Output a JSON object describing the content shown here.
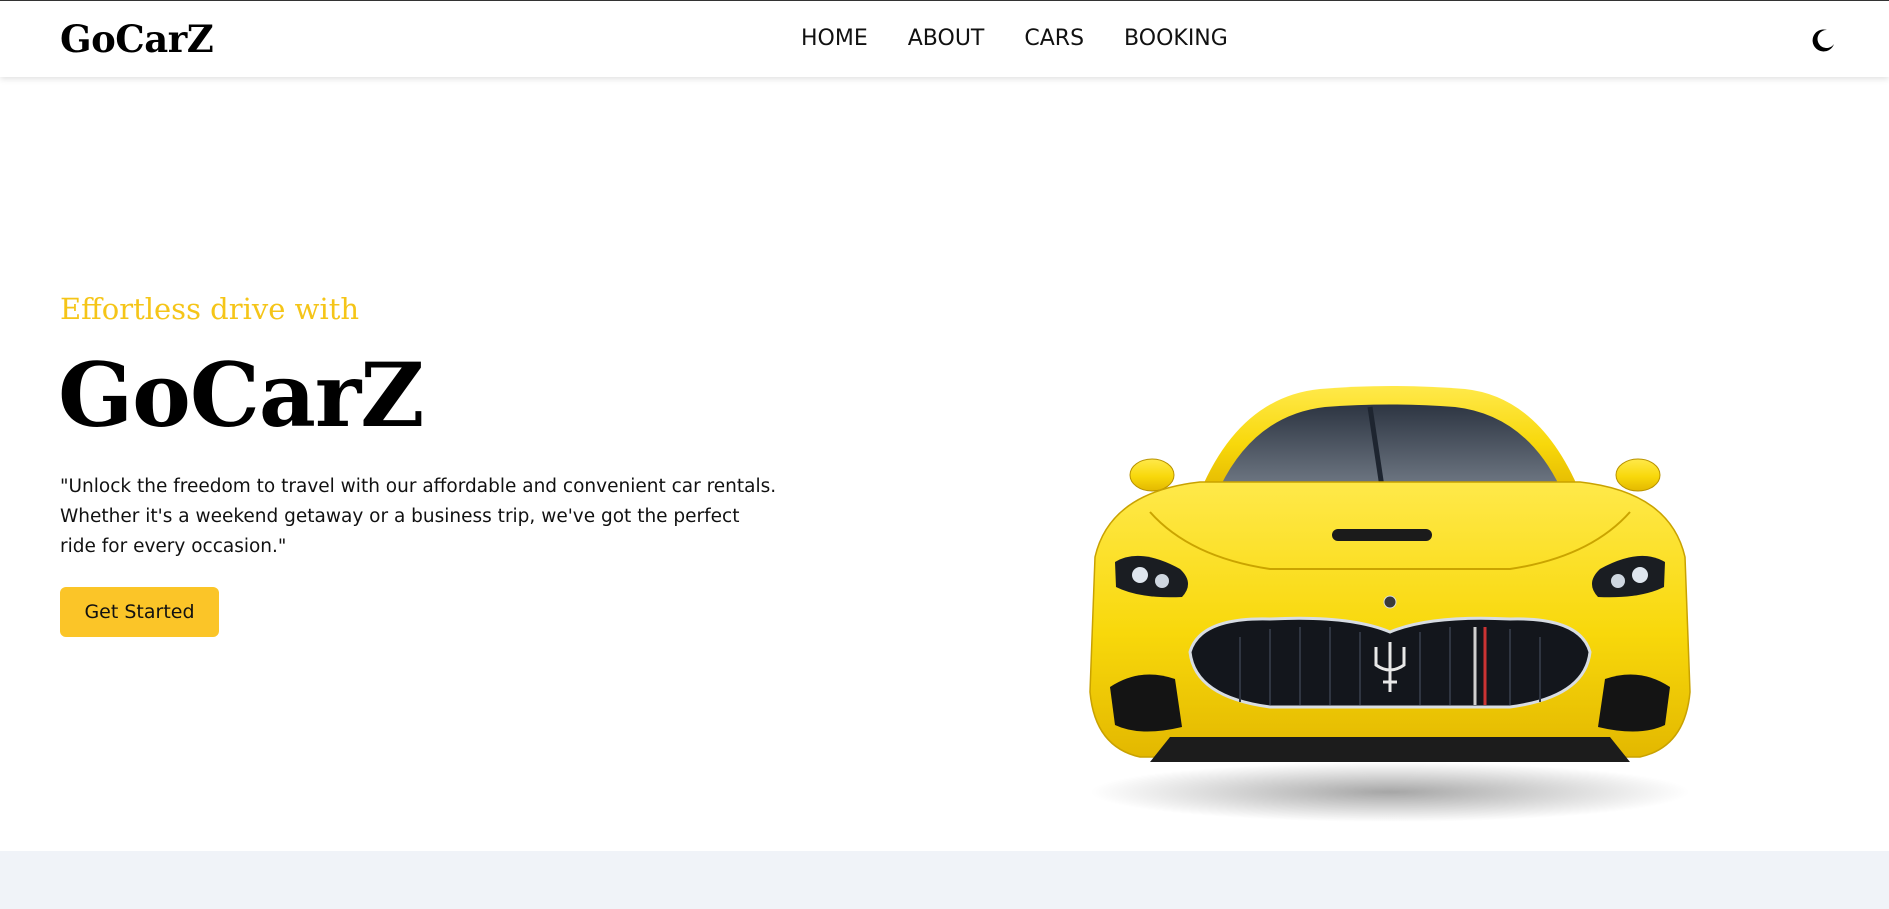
{
  "brand": {
    "logo_text": "GoCarZ"
  },
  "nav": {
    "items": [
      {
        "label": "HOME"
      },
      {
        "label": "ABOUT"
      },
      {
        "label": "CARS"
      },
      {
        "label": "BOOKING"
      }
    ],
    "theme_toggle_icon": "moon-icon"
  },
  "hero": {
    "tagline": "Effortless drive with",
    "title": "GoCarZ",
    "description": "\"Unlock the freedom to travel with our affordable and convenient car rentals. Whether it's a weekend getaway or a business trip, we've got the perfect ride for every occasion.\"",
    "cta_label": "Get Started",
    "image_icon": "yellow-sports-car-image"
  },
  "colors": {
    "accent": "#f5c518",
    "button": "#fbc528",
    "section_bg": "#f0f3f8"
  }
}
